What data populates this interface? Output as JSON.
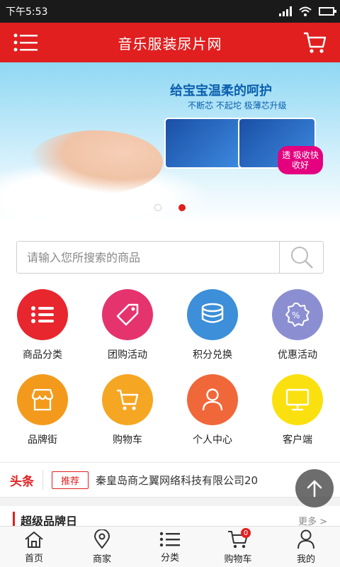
{
  "status_bar": {
    "time": "下午5:53",
    "icons": [
      "signal-icon",
      "wifi-icon",
      "battery-icon"
    ]
  },
  "header": {
    "title": "音乐服装尿片网",
    "menu_icon": "menu-icon",
    "cart_icon": "cart-icon",
    "color": "#e11f1f"
  },
  "banner": {
    "slogan": "给宝宝温柔的呵护",
    "sub_slogan": "不断芯 不起坨 极薄芯升级",
    "badge": "透 吸收快 收好",
    "slides": 2,
    "active_slide": 2
  },
  "search": {
    "placeholder": "请输入您所搜索的商品",
    "icon": "search-icon"
  },
  "shortcuts": [
    {
      "label": "商品分类",
      "icon": "list-icon",
      "color": "#e8262e"
    },
    {
      "label": "团购活动",
      "icon": "tag-icon",
      "color": "#e5336e"
    },
    {
      "label": "积分兑换",
      "icon": "coins-icon",
      "color": "#3c8fd8"
    },
    {
      "label": "优惠活动",
      "icon": "discount-icon",
      "color": "#8b8fd2"
    },
    {
      "label": "品牌街",
      "icon": "shop-icon",
      "color": "#f39a1c"
    },
    {
      "label": "购物车",
      "icon": "cart-icon",
      "color": "#f5a623"
    },
    {
      "label": "个人中心",
      "icon": "user-icon",
      "color": "#f0673a"
    },
    {
      "label": "客户端",
      "icon": "monitor-icon",
      "color": "#fbe00f"
    }
  ],
  "news": {
    "tag": "头条",
    "badge": "推荐",
    "text": "秦皇岛商之翼网络科技有限公司20"
  },
  "brand_section": {
    "title": "超级品牌日",
    "more": "更多 >"
  },
  "tabbar": {
    "items": [
      {
        "label": "首页",
        "icon": "home-icon"
      },
      {
        "label": "商家",
        "icon": "location-icon"
      },
      {
        "label": "分类",
        "icon": "list-icon"
      },
      {
        "label": "购物车",
        "icon": "cart-icon",
        "badge": "0"
      },
      {
        "label": "我的",
        "icon": "user-icon"
      }
    ]
  }
}
